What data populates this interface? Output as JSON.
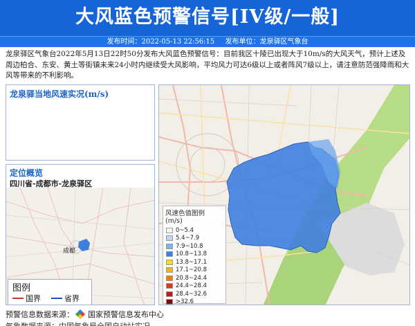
{
  "header": {
    "title": "大风蓝色预警信号[IV级/一般]",
    "publish_time_label": "发布时间：",
    "publish_time": "2022-05-13 22:56:15",
    "publisher_label": "发布单位：",
    "publisher": "龙泉驿区气象台"
  },
  "description": "龙泉驿区气象台2022年5月13日22时50分发布大风蓝色预警信号：目前我区十陵已出现大于10m/s的大风天气，预计上述及周边柏合、东安、黄土等街镇未来24小时内继续受大风影响，平均风力可达6级以上或者阵风7级以上，请注意防范强降雨和大风等带来的不利影响。",
  "wind_panel": {
    "title": "龙泉驿当地风速实况(m/s)"
  },
  "location_panel": {
    "title": "定位概览",
    "region": "四川省-成都市-龙泉驿区",
    "city_label": "成都",
    "legend": {
      "title": "图例",
      "items": [
        {
          "label": "国界",
          "color": "#c0392b"
        },
        {
          "label": "省界",
          "color": "#1f4fbf"
        }
      ]
    }
  },
  "map": {
    "legend_title": "风速色值图例 (m/s)",
    "scale": [
      {
        "label": "0~5.4",
        "color": "#f4f4f4"
      },
      {
        "label": "5.4~7.9",
        "color": "#bcd7f3"
      },
      {
        "label": "7.9~10.8",
        "color": "#7fb3ec"
      },
      {
        "label": "10.8~13.8",
        "color": "#3f7fe0"
      },
      {
        "label": "13.8~17.1",
        "color": "#f7d82a"
      },
      {
        "label": "17.1~20.8",
        "color": "#f5b31c"
      },
      {
        "label": "20.8~24.4",
        "color": "#ef7b14"
      },
      {
        "label": "24.4~28.4",
        "color": "#e4361c"
      },
      {
        "label": "28.4~32.6",
        "color": "#c01818"
      },
      {
        "label": ">32.6",
        "color": "#7d0a0a"
      }
    ],
    "alert_fill": "#3f7fe0"
  },
  "footer": {
    "source_label": "预警信息数据来源：",
    "source_name": "国家预警信息发布中心",
    "line2": "气象数据来源：中国气象局全国自动站实况"
  }
}
